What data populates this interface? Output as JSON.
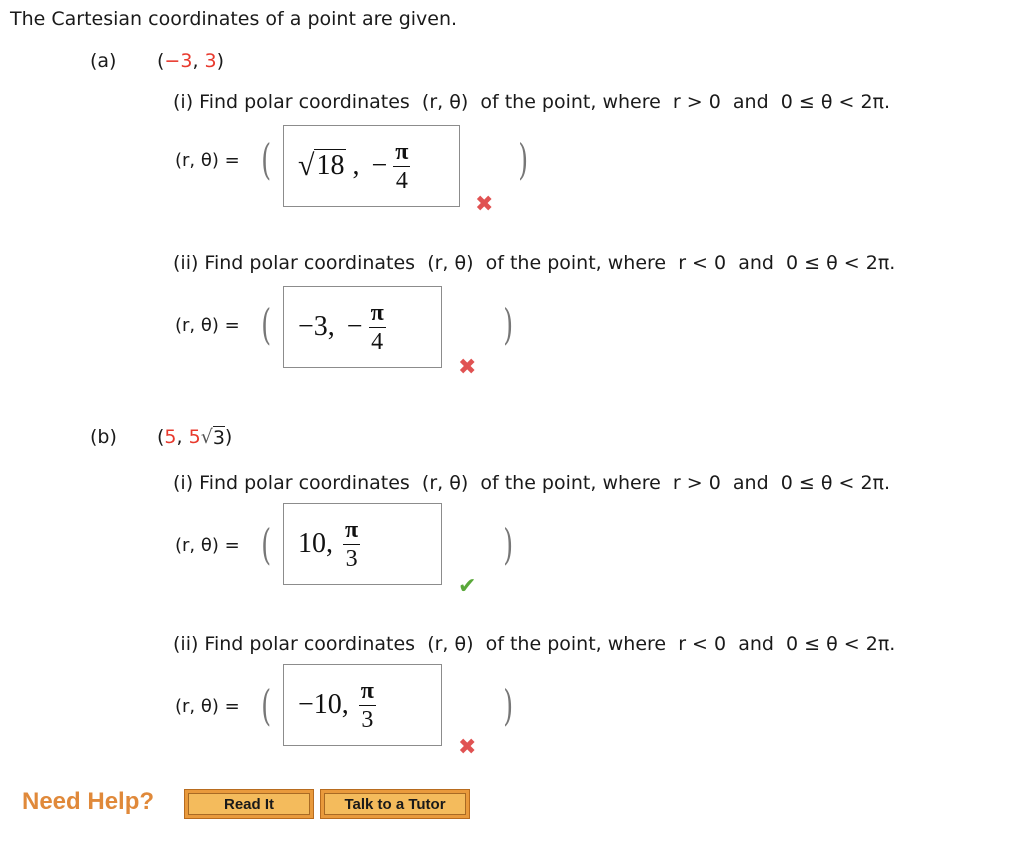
{
  "intro": "The Cartesian coordinates of a point are given.",
  "parts": [
    {
      "label": "(a)",
      "point": {
        "open": "(",
        "x": "−3",
        "sep": ", ",
        "y": "3",
        "close": ")"
      },
      "questions": [
        {
          "prefix": "(i) Find polar coordinates",
          "rtheta": "(r, θ)",
          "middle": "of the point, where",
          "r_cond": "r > 0",
          "and": "and",
          "theta_cond": "0 ≤ θ < 2π.",
          "eq_label": "(r, θ) =",
          "answer": {
            "r_sqrt": "18",
            "r": "",
            "sep": ",",
            "sign": "−",
            "num": "π",
            "den": "4"
          },
          "status": "incorrect",
          "status_icon": "✖"
        },
        {
          "prefix": "(ii) Find polar coordinates",
          "rtheta": "(r, θ)",
          "middle": "of the point, where",
          "r_cond": "r < 0",
          "and": "and",
          "theta_cond": "0 ≤ θ < 2π.",
          "eq_label": "(r, θ) =",
          "answer": {
            "r": "−3,",
            "sign": "−",
            "num": "π",
            "den": "4"
          },
          "status": "incorrect",
          "status_icon": "✖"
        }
      ]
    },
    {
      "label": "(b)",
      "point": {
        "open": "(",
        "x": "5",
        "sep": ", ",
        "y": "5",
        "y_sqrt": "3",
        "close": ")"
      },
      "questions": [
        {
          "prefix": "(i) Find polar coordinates",
          "rtheta": "(r, θ)",
          "middle": "of the point, where",
          "r_cond": "r > 0",
          "and": "and",
          "theta_cond": "0 ≤ θ < 2π.",
          "eq_label": "(r, θ) =",
          "answer": {
            "r": "10,",
            "num": "π",
            "den": "3"
          },
          "status": "correct",
          "status_icon": "✔"
        },
        {
          "prefix": "(ii) Find polar coordinates",
          "rtheta": "(r, θ)",
          "middle": "of the point, where",
          "r_cond": "r < 0",
          "and": "and",
          "theta_cond": "0 ≤ θ < 2π.",
          "eq_label": "(r, θ) =",
          "answer": {
            "r": "−10,",
            "num": "π",
            "den": "3"
          },
          "status": "incorrect",
          "status_icon": "✖"
        }
      ]
    }
  ],
  "paren_open": "(",
  "paren_close": ")",
  "help": {
    "label": "Need Help?",
    "read_it": "Read It",
    "talk_to_tutor": "Talk to a Tutor"
  },
  "colors": {
    "given_value": "#e8392d",
    "incorrect": "#e05252",
    "correct": "#5aa83a",
    "help_label": "#e0893a",
    "button": "#f4bb5c"
  }
}
